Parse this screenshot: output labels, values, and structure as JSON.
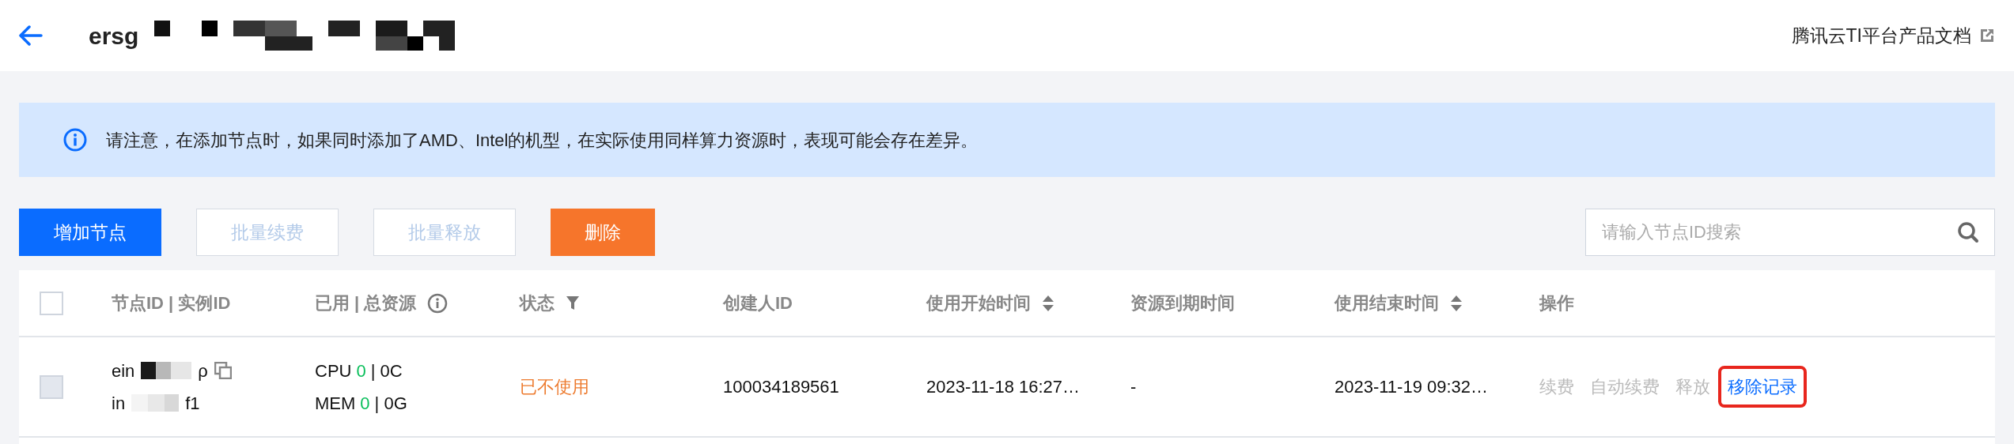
{
  "header": {
    "title": "ersg",
    "doc_link": "腾讯云TI平台产品文档"
  },
  "notice": {
    "text": "请注意，在添加节点时，如果同时添加了AMD、Intel的机型，在实际使用同样算力资源时，表现可能会存在差异。"
  },
  "toolbar": {
    "buttons": [
      {
        "label": "增加节点",
        "kind": "primary",
        "disabled": false
      },
      {
        "label": "批量续费",
        "kind": "default",
        "disabled": true
      },
      {
        "label": "批量释放",
        "kind": "default",
        "disabled": true
      },
      {
        "label": "删除",
        "kind": "danger",
        "disabled": false
      }
    ],
    "search": {
      "placeholder": "请输入节点ID搜索"
    }
  },
  "table": {
    "select_all": {
      "checked": false
    },
    "columns": [
      {
        "label": "节点ID | 实例ID",
        "kind": "plain"
      },
      {
        "label": "已用 | 总资源",
        "kind": "info"
      },
      {
        "label": "状态",
        "kind": "filter"
      },
      {
        "label": "创建人ID",
        "kind": "plain"
      },
      {
        "label": "使用开始时间",
        "kind": "sort"
      },
      {
        "label": "资源到期时间",
        "kind": "plain"
      },
      {
        "label": "使用结束时间",
        "kind": "sort"
      },
      {
        "label": "操作",
        "kind": "plain"
      }
    ],
    "rows": [
      {
        "checked": false,
        "disabled": true,
        "node_id": {
          "start": "ein",
          "end": "ρ"
        },
        "instance_id": {
          "start": "in",
          "end": "f1"
        },
        "resources": [
          {
            "label": "CPU",
            "used": "0",
            "rest": "| 0C"
          },
          {
            "label": "MEM",
            "used": "0",
            "rest": "| 0G"
          }
        ],
        "status": {
          "text": "已不使用",
          "kind": "inactive"
        },
        "creator_id": "100034189561",
        "start_time": "2023-11-18 16:27…",
        "expire_time": "-",
        "end_time": "2023-11-19 09:32…",
        "actions": [
          {
            "label": "续费",
            "disabled": true,
            "highlighted": false
          },
          {
            "label": "自动续费",
            "disabled": true,
            "highlighted": false
          },
          {
            "label": "释放",
            "disabled": true,
            "highlighted": false
          },
          {
            "label": "移除记录",
            "disabled": false,
            "highlighted": true
          }
        ]
      }
    ]
  }
}
